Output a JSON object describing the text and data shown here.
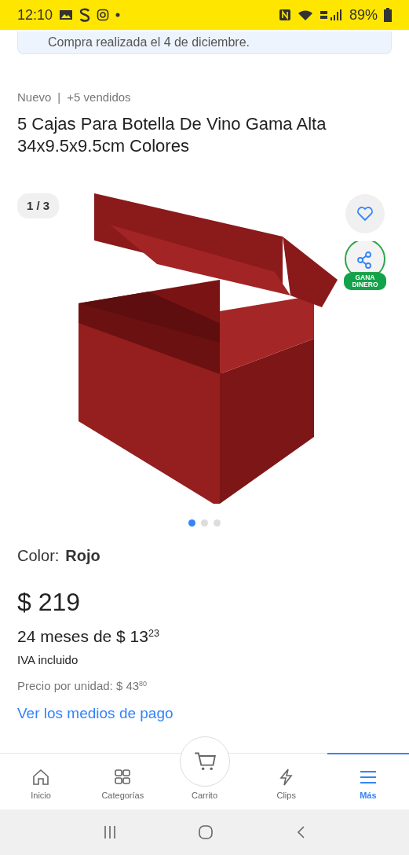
{
  "status_bar": {
    "time": "12:10",
    "battery": "89%"
  },
  "purchase_notice": {
    "text": "Compra realizada el 4 de diciembre."
  },
  "product": {
    "condition": "Nuevo",
    "separator": "|",
    "sold": "+5 vendidos",
    "title": "5 Cajas Para Botella De Vino Gama Alta 34x9.5x9.5cm Colores"
  },
  "gallery": {
    "counter": "1 / 3",
    "favorited": false,
    "share_badge": "GANA DINERO",
    "dots": [
      {
        "selected": true
      },
      {
        "selected": false
      },
      {
        "selected": false
      }
    ]
  },
  "color": {
    "label": "Color:",
    "value": "Rojo"
  },
  "price": {
    "amount": "$ 219",
    "installments": "24 meses de $ 13$^{23}$",
    "tax": "IVA incluido",
    "unit_price": "Precio por unidad: $ 43$^{80}$",
    "payment_link": "Ver los medios de pago"
  },
  "bottom_nav": [
    {
      "kind": "home",
      "label": "Inicio",
      "selected": false
    },
    {
      "kind": "grid",
      "label": "Categorías",
      "selected": false
    },
    {
      "kind": "cart",
      "label": "Carrito",
      "selected": false
    },
    {
      "kind": "bolt",
      "label": "Clips",
      "selected": false
    },
    {
      "kind": "menu",
      "label": "Más",
      "selected": true
    }
  ]
}
